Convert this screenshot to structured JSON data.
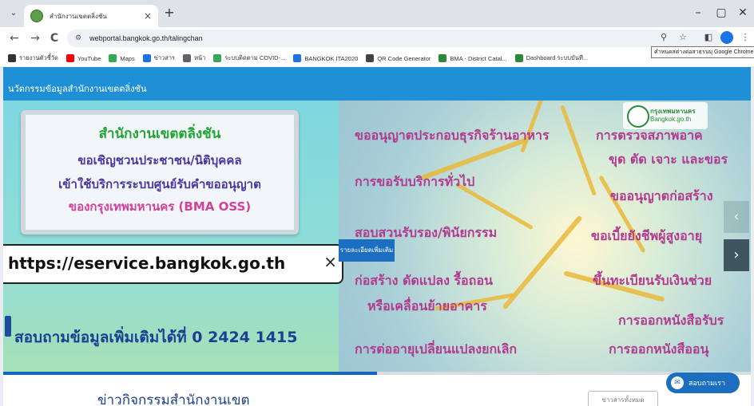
{
  "browser": {
    "tab_title": "สำนักงานเขตตลิ่งชัน",
    "tab_close": "×",
    "new_tab": "+",
    "menu_chevron": "⌄",
    "minimize": "–",
    "maximize": "▢",
    "close": "✕",
    "back": "←",
    "forward": "→",
    "reload": "C",
    "site_info": "⚙",
    "url": "webportal.bangkok.go.th/talingchan",
    "zoom_icon": "⚲",
    "star_icon": "☆",
    "sidepanel_icon": "◧",
    "more_icon": "⋮",
    "tooltip": "คำหนดสต่างต่อสาธรนมุ Google Chrome"
  },
  "bookmarks": [
    {
      "label": "รายงานตัวชี้วัด",
      "color": "#333333"
    },
    {
      "label": "YouTube",
      "color": "#ff0000"
    },
    {
      "label": "Maps",
      "color": "#34a853"
    },
    {
      "label": "ข่าวสาร",
      "color": "#1a73e8"
    },
    {
      "label": "หน้า",
      "color": "#5f6368"
    },
    {
      "label": "ระบบติดตาม COVID-...",
      "color": "#34a853"
    },
    {
      "label": "BANGKOK ITA2020",
      "color": "#1a73e8"
    },
    {
      "label": "QR Code Generator",
      "color": "#444444"
    },
    {
      "label": "BMA - District Catal...",
      "color": "#2a8a3a"
    },
    {
      "label": "Dashboard ระบบบันที...",
      "color": "#2a8a3a"
    }
  ],
  "site": {
    "header_title": "นวัตกรรมข้อมูลสำนักงานเขตตลิ่งชัน"
  },
  "banner": {
    "card_line1": "สำนักงานเขตตลิ่งชัน",
    "card_line2": "ขอเชิญชวนประชาชน/นิติบุคคล",
    "card_line3": "เข้าใช้บริการระบบศูนย์รับคำขออนุญาต",
    "card_line4": "ของกรุงเทพมหานคร (BMA OSS)",
    "url_text": "https://eservice.bangkok.go.th",
    "url_close": "×",
    "contact_text": "สอบถามข้อมูลเพิ่มเติมได้ที่ 0 2424 1415",
    "logo_line1": "กรุงเทพมหานคร",
    "logo_line2": "Bangkok.go.th",
    "services": [
      "ขออนุญาตประกอบธุรกิจร้านอาหาร",
      "การตรวจสภาพอาค",
      "ขุด ตัด เจาะ และขอร",
      "การขอรับบริการทั่วไป",
      "ขออนุญาตก่อสร้าง",
      "สอบสวนรับรอง/พินัยกรรม",
      "ขอเบี้ยยังชีพผู้สูงอายุ",
      "ก่อสร้าง ดัดแปลง รื้อถอน",
      "ขึ้นทะเบียนรับเงินช่วย",
      "หรือเคลื่อนย้ายอาคาร",
      "การออกหนังสือรับร",
      "การต่ออายุเปลี่ยนแปลงยกเลิก",
      "การออกหนังสืออนุ"
    ],
    "more_button": "รายละเอียดเพิ่มเติม",
    "prev_arrow": "‹",
    "next_arrow": "›",
    "progress": 0.5
  },
  "news": {
    "title": "ข่าวกิจกรรมสำนักงานเขต",
    "view_all": "ข่าวสารทั้งหมด"
  },
  "chat": {
    "label": "สอบถามเรา",
    "icon": "✉"
  },
  "colors": {
    "header_blue": "#1f8fd6",
    "card_green": "#21a436",
    "card_purple": "#4b36a0",
    "card_pink": "#d2429a",
    "service_magenta": "#b13b8e",
    "contact_blue": "#1a3f93",
    "progress_blue": "#1466b7"
  }
}
